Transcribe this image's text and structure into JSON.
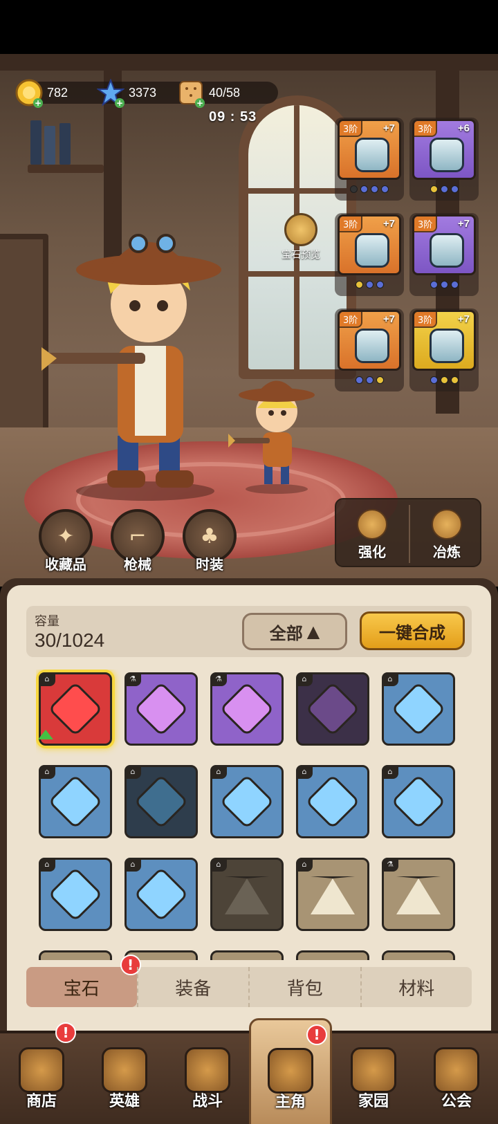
{
  "resources": {
    "gold": "782",
    "gems": "3373",
    "stamina": "40/58",
    "timer": "09 : 53"
  },
  "equipment": [
    {
      "tier": "3阶",
      "level": "+7",
      "rarity": "orange",
      "icon": "helmet-icon",
      "dots": [
        "#333333",
        "#5b6ed6",
        "#5b6ed6",
        "#5b6ed6"
      ]
    },
    {
      "tier": "3阶",
      "level": "+6",
      "rarity": "purple",
      "icon": "armor-icon",
      "dots": [
        "#e8c23a",
        "#5b6ed6",
        "#5b6ed6"
      ]
    },
    {
      "tier": "3阶",
      "level": "+7",
      "rarity": "orange",
      "icon": "boots-icon",
      "dots": [
        "#e8c23a",
        "#5b6ed6",
        "#5b6ed6"
      ]
    },
    {
      "tier": "3阶",
      "level": "+7",
      "rarity": "purple",
      "icon": "gloves-icon",
      "dots": [
        "#5b6ed6",
        "#5b6ed6",
        "#5b6ed6"
      ]
    },
    {
      "tier": "3阶",
      "level": "+7",
      "rarity": "orange",
      "icon": "cape-icon",
      "dots": [
        "#5b6ed6",
        "#5b6ed6",
        "#e8c23a"
      ]
    },
    {
      "tier": "3阶",
      "level": "+7",
      "rarity": "gold",
      "icon": "pants-icon",
      "dots": [
        "#5b6ed6",
        "#e8c23a",
        "#e8c23a"
      ]
    }
  ],
  "gem_preview_label": "宝石预览",
  "round_buttons": [
    "收藏品",
    "枪械",
    "时装"
  ],
  "actions": [
    "强化",
    "冶炼"
  ],
  "inventory": {
    "capacity_label": "容量",
    "capacity_value": "30/1024",
    "filter_label": "全部",
    "merge_label": "一键合成",
    "gems": [
      {
        "color": "red",
        "selected": true,
        "upgrade": true
      },
      {
        "color": "purple"
      },
      {
        "color": "purple"
      },
      {
        "color": "darkpurple"
      },
      {
        "color": "blue"
      },
      {
        "color": "blue"
      },
      {
        "color": "darkblue"
      },
      {
        "color": "blue"
      },
      {
        "color": "blue"
      },
      {
        "color": "blue"
      },
      {
        "color": "blue"
      },
      {
        "color": "blue"
      },
      {
        "color": "darkstone"
      },
      {
        "color": "stone"
      },
      {
        "color": "stone"
      }
    ]
  },
  "tabs": [
    "宝石",
    "装备",
    "背包",
    "材料"
  ],
  "nav": [
    "商店",
    "英雄",
    "战斗",
    "主角",
    "家园",
    "公会"
  ],
  "alert_symbol": "!"
}
